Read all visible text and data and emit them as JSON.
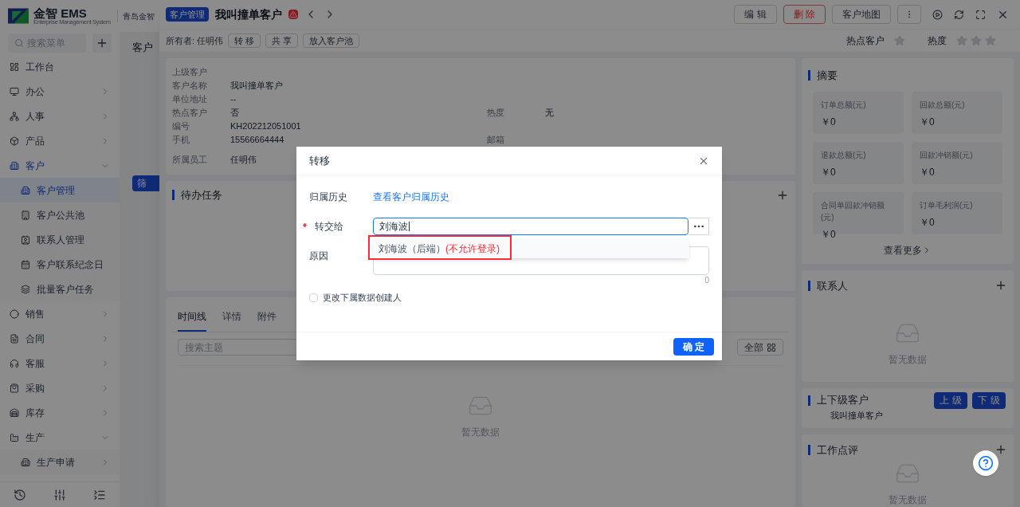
{
  "app": {
    "logo_text": "金智 EMS",
    "logo_subtitle": "Enterprise Management System",
    "company": "青岛金智"
  },
  "sidebar": {
    "search_placeholder": "搜索菜单",
    "items": [
      {
        "label": "工作台",
        "selected": false
      },
      {
        "label": "办公",
        "selected": false,
        "expanded": false
      },
      {
        "label": "人事",
        "selected": false,
        "expanded": false
      },
      {
        "label": "产品",
        "selected": false,
        "expanded": false
      },
      {
        "label": "客户",
        "selected": false,
        "expanded": true,
        "children": [
          {
            "label": "客户管理",
            "selected": true
          },
          {
            "label": "客户公共池",
            "selected": false
          },
          {
            "label": "联系人管理",
            "selected": false
          },
          {
            "label": "客户联系纪念日",
            "selected": false
          },
          {
            "label": "批量客户任务",
            "selected": false
          }
        ]
      },
      {
        "label": "销售",
        "selected": false,
        "expanded": false
      },
      {
        "label": "合同",
        "selected": false,
        "expanded": false
      },
      {
        "label": "客服",
        "selected": false,
        "expanded": false
      },
      {
        "label": "采购",
        "selected": false,
        "expanded": false
      },
      {
        "label": "库存",
        "selected": false,
        "expanded": false
      },
      {
        "label": "生产",
        "selected": false,
        "expanded": true,
        "children": [
          {
            "label": "生产申请",
            "selected": false,
            "expanded": false
          }
        ]
      }
    ]
  },
  "list_page": {
    "title": "客户",
    "filter_button": "筛"
  },
  "drawer": {
    "tag": "客户管理",
    "title": "我叫撞单客户",
    "actions": [
      {
        "label": "编 辑",
        "kind": "default"
      },
      {
        "label": "删 除",
        "kind": "danger"
      },
      {
        "label": "客户地图",
        "kind": "default"
      }
    ],
    "owner_label": "所有者:",
    "owner": "任明伟",
    "owner_actions": [
      "转 移",
      "共 享",
      "放入客户池"
    ],
    "ratings": [
      {
        "label": "热点客户",
        "kind": "flag",
        "on": false
      },
      {
        "label": "热度",
        "kind": "scale",
        "stars": 0
      }
    ],
    "info": [
      {
        "cells": [
          {
            "label": "上级客户"
          }
        ]
      },
      {
        "cells": [
          {
            "label": "客户名称",
            "value": "我叫撞单客户"
          }
        ]
      },
      {
        "cells": [
          {
            "label": "单位地址",
            "value": "--"
          }
        ]
      },
      {
        "cells": [
          {
            "label": "热点客户",
            "value": "否"
          },
          {
            "label": "热度",
            "value": "无"
          }
        ]
      },
      {
        "cells": [
          {
            "label": "编号",
            "value": "KH202212051001"
          }
        ]
      },
      {
        "cells": [
          {
            "label": "手机",
            "value": "15566664444"
          },
          {
            "label": "邮箱"
          }
        ]
      },
      {
        "cells": [
          {
            "label": "所属员工",
            "value": "任明伟"
          }
        ]
      }
    ],
    "tasks": {
      "title": "待办任务"
    },
    "activity": {
      "tabs": [
        {
          "label": "时间线",
          "selected": true
        },
        {
          "label": "详情",
          "selected": false
        },
        {
          "label": "附件",
          "selected": false
        }
      ],
      "search_placeholder": "搜索主题",
      "all_button": "全部",
      "empty": "暂无数据"
    },
    "summary": {
      "title": "摘要",
      "stats": [
        {
          "label": "订单总额(元)",
          "value": "￥0"
        },
        {
          "label": "回款总额(元)",
          "value": "￥0"
        },
        {
          "label": "退款总额(元)",
          "value": "￥0"
        },
        {
          "label": "回款冲销额(元)",
          "value": "￥0"
        },
        {
          "label": "合同单回款冲销额(元)",
          "value": "￥0"
        },
        {
          "label": "订单毛利润(元)",
          "value": "￥0"
        }
      ],
      "more": "查看更多"
    },
    "contacts": {
      "title": "联系人",
      "empty": "暂无数据"
    },
    "hierarchy": {
      "title": "上下级客户",
      "buttons": [
        "上 级",
        "下 级"
      ],
      "item": "我叫撞单客户"
    },
    "reviews": {
      "title": "工作点评",
      "empty": "暂无数据"
    }
  },
  "dialog": {
    "title": "转移",
    "fields": [
      {
        "kind": "link",
        "label": "归属历史",
        "value": "查看客户归属历史",
        "required": false
      },
      {
        "kind": "picker",
        "label": "转交给",
        "value": "刘海波",
        "required": true
      },
      {
        "kind": "textarea",
        "label": "原因",
        "count": "0",
        "required": false
      }
    ],
    "suggestion": {
      "name": "刘海波（后端）",
      "note": "(不允许登录)"
    },
    "checkbox": {
      "label": "更改下属数据创建人",
      "checked": false
    },
    "confirm": "确 定"
  }
}
